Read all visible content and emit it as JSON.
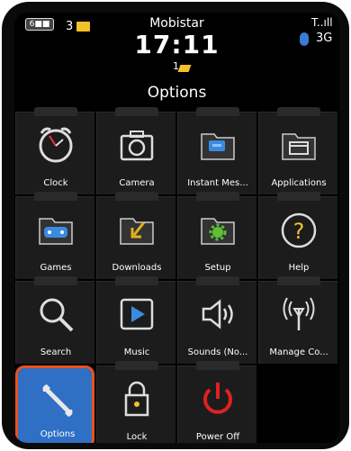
{
  "status": {
    "battery": "6■■",
    "mail_count": "3",
    "carrier": "Mobistar",
    "time": "17:11",
    "note_count": "1",
    "network": "3G",
    "signal": "T..ıll"
  },
  "title": "Options",
  "apps": [
    {
      "label": "Clock",
      "icon": "clock-icon"
    },
    {
      "label": "Camera",
      "icon": "camera-icon"
    },
    {
      "label": "Instant Mes...",
      "icon": "instant-messaging-icon"
    },
    {
      "label": "Applications",
      "icon": "applications-icon"
    },
    {
      "label": "Games",
      "icon": "games-icon"
    },
    {
      "label": "Downloads",
      "icon": "downloads-icon"
    },
    {
      "label": "Setup",
      "icon": "setup-icon"
    },
    {
      "label": "Help",
      "icon": "help-icon"
    },
    {
      "label": "Search",
      "icon": "search-icon"
    },
    {
      "label": "Music",
      "icon": "music-icon"
    },
    {
      "label": "Sounds (No...",
      "icon": "sounds-icon"
    },
    {
      "label": "Manage Co...",
      "icon": "manage-connections-icon"
    },
    {
      "label": "Options",
      "icon": "options-icon"
    },
    {
      "label": "Lock",
      "icon": "lock-icon"
    },
    {
      "label": "Power Off",
      "icon": "power-off-icon"
    }
  ],
  "selected": "Options"
}
